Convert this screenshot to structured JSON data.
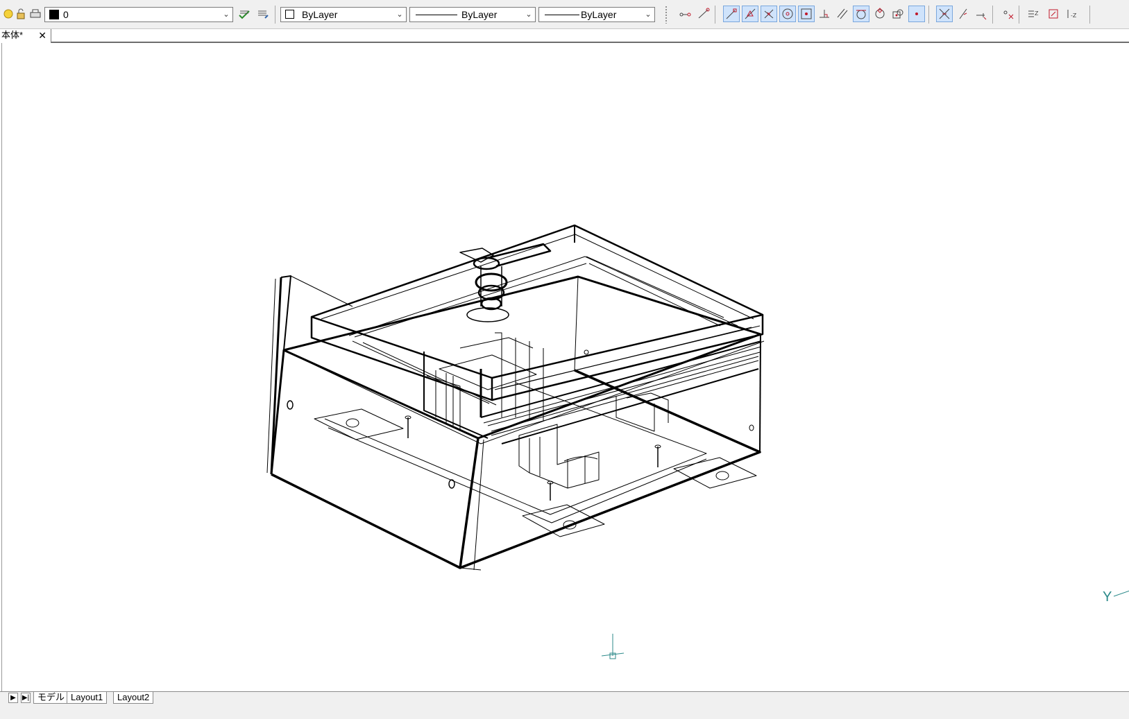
{
  "toolbar": {
    "layer_value": "0",
    "color_value": "ByLayer",
    "linetype_value": "ByLayer",
    "lineweight_value": "ByLayer"
  },
  "document": {
    "tab_title": "本体*"
  },
  "layouts": {
    "tabs": [
      "モデル",
      "Layout1",
      "Layout2"
    ]
  },
  "ucs": {
    "y_label": "Y"
  },
  "colors": {
    "toolbar_bg": "#f0f0f0",
    "snap_active": "#cfe3fb",
    "snap_icon": "#c0182a",
    "ucs_icon": "#2c8a8a"
  }
}
